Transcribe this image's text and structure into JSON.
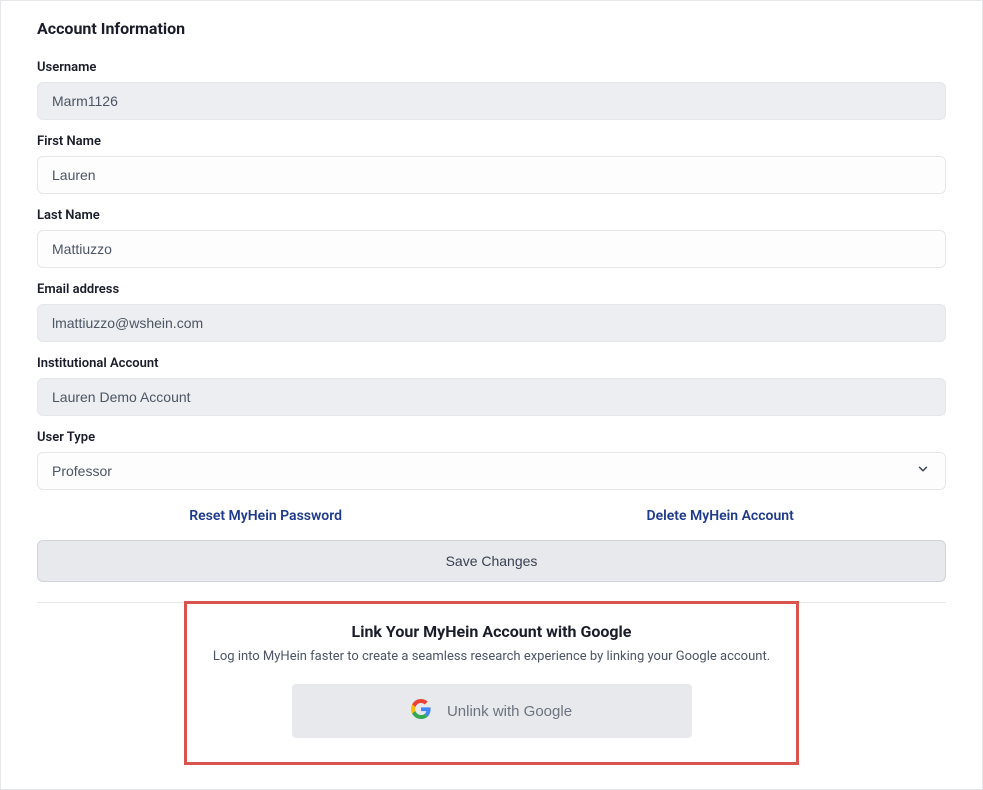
{
  "section_title": "Account Information",
  "fields": {
    "username": {
      "label": "Username",
      "value": "Marm1126"
    },
    "first_name": {
      "label": "First Name",
      "value": "Lauren"
    },
    "last_name": {
      "label": "Last Name",
      "value": "Mattiuzzo"
    },
    "email": {
      "label": "Email address",
      "value": "lmattiuzzo@wshein.com"
    },
    "institutional_account": {
      "label": "Institutional Account",
      "value": "Lauren Demo Account"
    },
    "user_type": {
      "label": "User Type",
      "value": "Professor"
    }
  },
  "actions": {
    "reset_password": "Reset MyHein Password",
    "delete_account": "Delete MyHein Account",
    "save_changes": "Save Changes"
  },
  "google_link": {
    "title": "Link Your MyHein Account with Google",
    "description": "Log into MyHein faster to create a seamless research experience by linking your Google account.",
    "button_label": "Unlink with Google"
  }
}
